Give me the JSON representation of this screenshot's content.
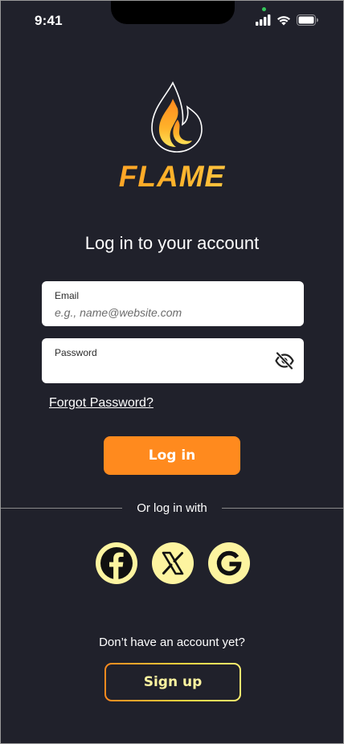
{
  "status_bar": {
    "time": "9:41",
    "icons": [
      "signal-icon",
      "wifi-icon",
      "battery-icon"
    ]
  },
  "brand": {
    "logo_icon": "flame-icon",
    "name": "FLAME"
  },
  "heading": "Log in to your account",
  "form": {
    "email": {
      "label": "Email",
      "value": "",
      "placeholder": "e.g., name@website.com"
    },
    "password": {
      "label": "Password",
      "value": "",
      "toggle_icon": "eye-off-icon"
    },
    "forgot_link": "Forgot Password?",
    "login_label": "Log in"
  },
  "social": {
    "divider_text": "Or log in with",
    "providers": [
      "facebook-icon",
      "x-icon",
      "google-icon"
    ]
  },
  "signup": {
    "prompt": "Don’t have an account yet?",
    "button_label": "Sign up"
  },
  "colors": {
    "background": "#20212b",
    "accent": "#ff8a1e",
    "social_bg": "#fdf4a0",
    "signup_text": "#fdf4a0"
  }
}
